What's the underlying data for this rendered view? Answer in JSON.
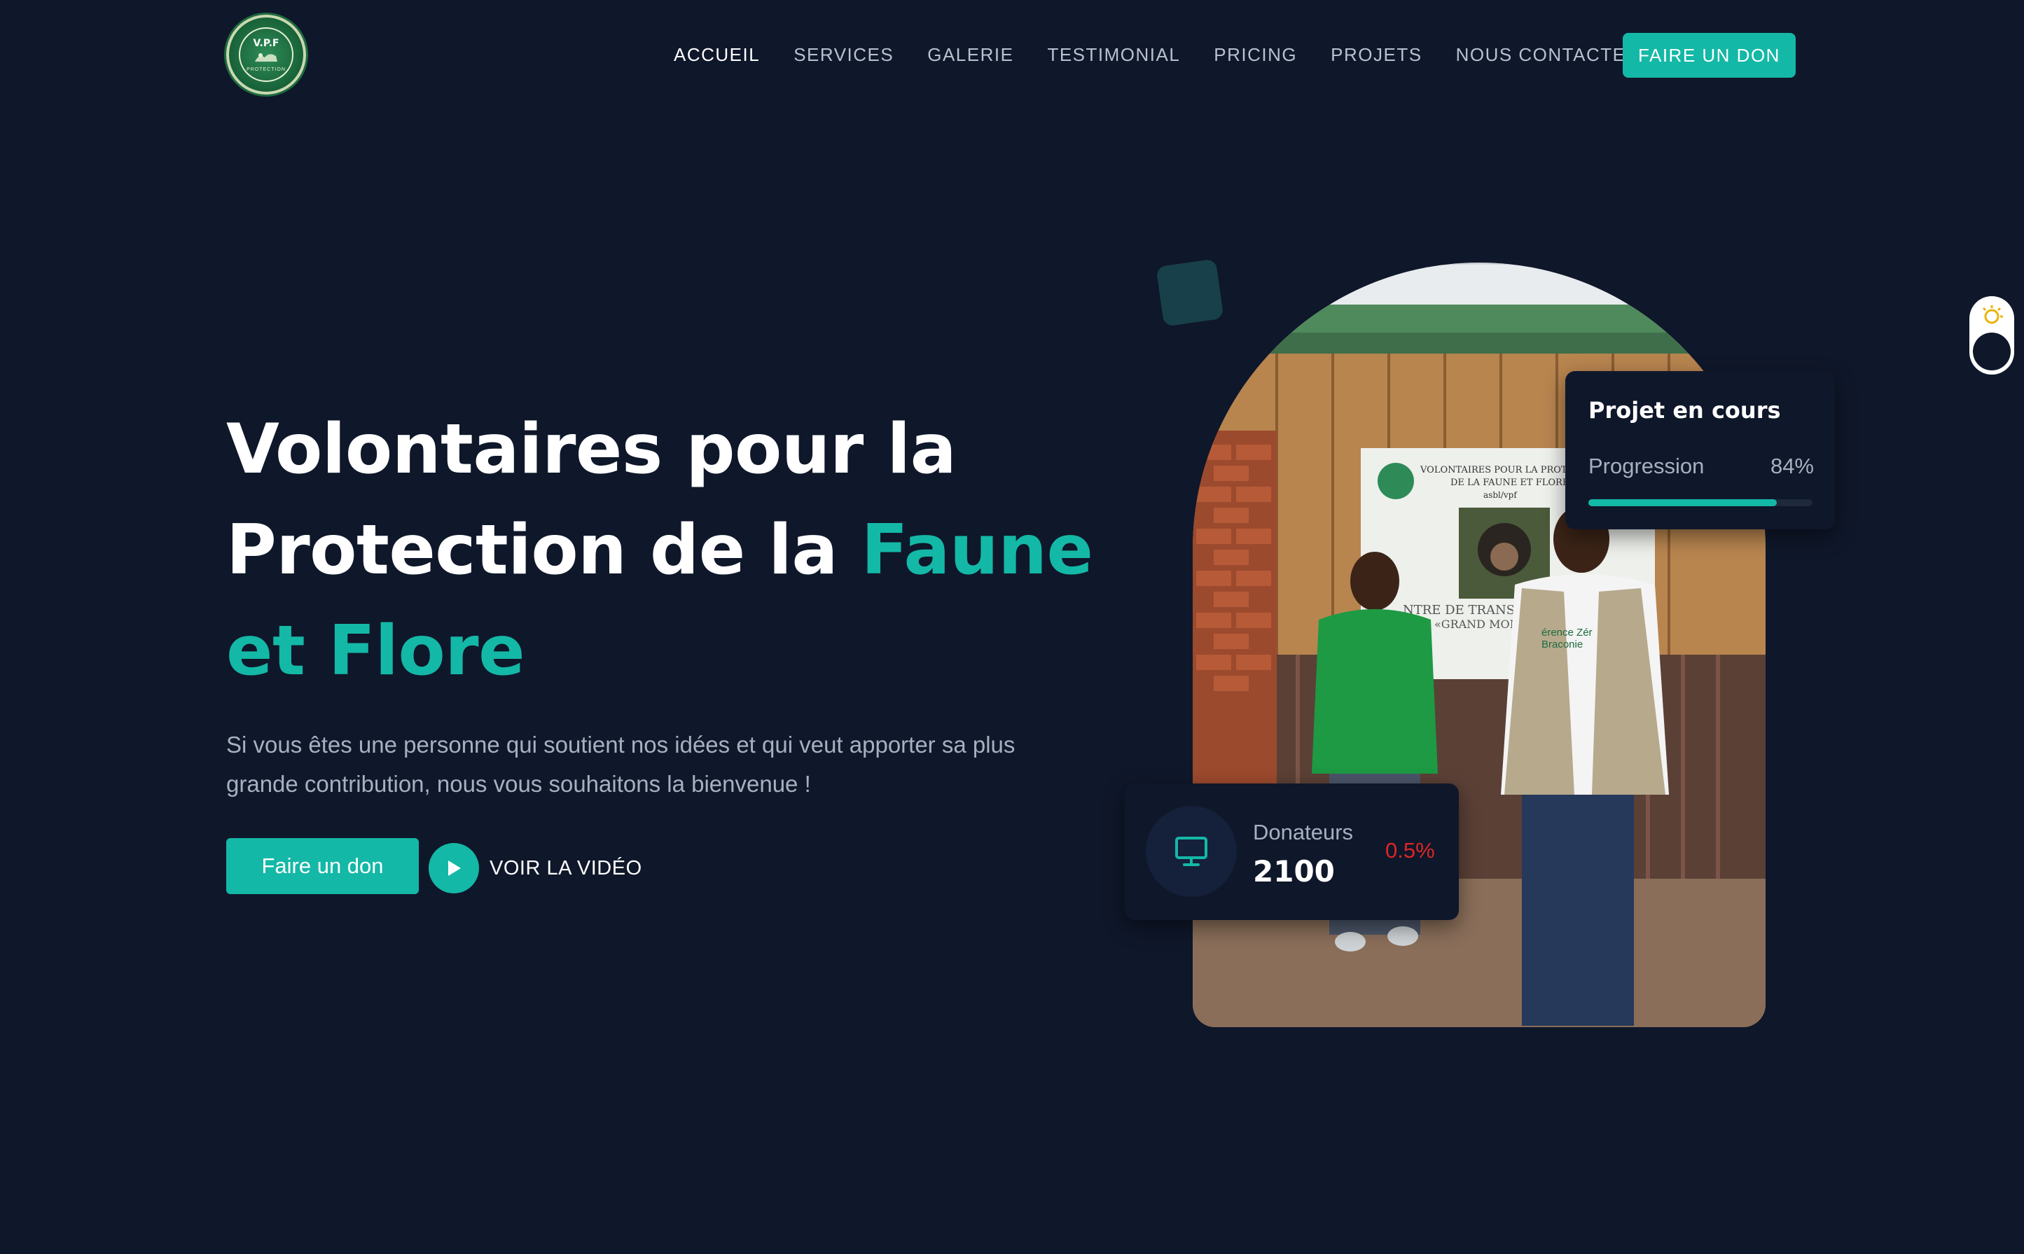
{
  "brand": {
    "logo_text": "V.P.F",
    "logo_subtext": "PROTECTION"
  },
  "nav": {
    "items": [
      {
        "label": "ACCUEIL",
        "active": true
      },
      {
        "label": "SERVICES",
        "active": false
      },
      {
        "label": "GALERIE",
        "active": false
      },
      {
        "label": "TESTIMONIAL",
        "active": false
      },
      {
        "label": "PRICING",
        "active": false
      },
      {
        "label": "PROJETS",
        "active": false
      },
      {
        "label": "NOUS CONTACTER",
        "active": false
      }
    ],
    "cta_label": "FAIRE UN DON"
  },
  "hero": {
    "title_part1": "Volontaires pour la",
    "title_part2": "Protection de la ",
    "title_accent": "Faune et Flore",
    "description": "Si vous êtes une personne qui soutient nos idées et qui veut apporter sa plus grande contribution, nous vous souhaitons la bienvenue !",
    "donate_label": "Faire un don",
    "video_label": "VOIR LA VIDÉO"
  },
  "photo": {
    "sign_line1": "VOLONTAIRES POUR LA PROTEC",
    "sign_line2": "DE LA FAUNE ET FLORE",
    "sign_line3": "asbl/vpf",
    "sign_line4": "NTRE DE TRANSIT DE",
    "sign_line5": "«GRAND MON",
    "vest_text1": "érence Zér",
    "vest_text2": "Braconie"
  },
  "project_card": {
    "title": "Projet en cours",
    "progress_label": "Progression",
    "progress_value": "84%",
    "progress_fraction": 0.84
  },
  "donor_card": {
    "icon": "monitor-icon",
    "label": "Donateurs",
    "value": "2100",
    "change": "0.5%"
  },
  "colors": {
    "background": "#0f172a",
    "accent": "#14b8a6",
    "muted_text": "#a7b0bf",
    "negative": "#dc2626"
  }
}
